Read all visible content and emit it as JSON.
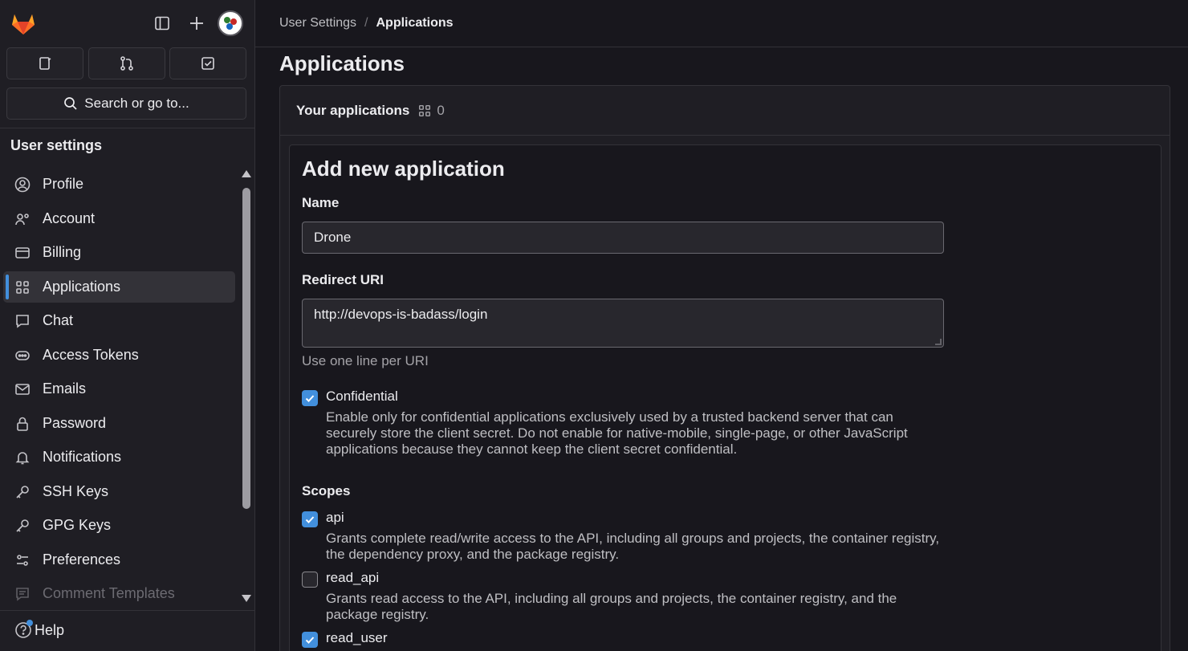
{
  "sidebar": {
    "search_label": "Search or go to...",
    "section_title": "User settings",
    "items": [
      {
        "label": "Profile",
        "icon": "profile-icon"
      },
      {
        "label": "Account",
        "icon": "account-icon"
      },
      {
        "label": "Billing",
        "icon": "billing-icon"
      },
      {
        "label": "Applications",
        "icon": "applications-icon",
        "active": true
      },
      {
        "label": "Chat",
        "icon": "chat-icon"
      },
      {
        "label": "Access Tokens",
        "icon": "token-icon"
      },
      {
        "label": "Emails",
        "icon": "mail-icon"
      },
      {
        "label": "Password",
        "icon": "lock-icon"
      },
      {
        "label": "Notifications",
        "icon": "bell-icon"
      },
      {
        "label": "SSH Keys",
        "icon": "key-icon"
      },
      {
        "label": "GPG Keys",
        "icon": "key-icon"
      },
      {
        "label": "Preferences",
        "icon": "preferences-icon"
      },
      {
        "label": "Comment Templates",
        "icon": "comment-icon"
      }
    ],
    "help_label": "Help"
  },
  "breadcrumb": {
    "parent": "User Settings",
    "separator": "/",
    "current": "Applications"
  },
  "page": {
    "title": "Applications",
    "your_apps_label": "Your applications",
    "app_count": "0"
  },
  "form": {
    "heading": "Add new application",
    "name_label": "Name",
    "name_value": "Drone",
    "redirect_label": "Redirect URI",
    "redirect_value": "http://devops-is-badass/login",
    "redirect_help": "Use one line per URI",
    "confidential_label": "Confidential",
    "confidential_checked": true,
    "confidential_desc": "Enable only for confidential applications exclusively used by a trusted backend server that can securely store the client secret. Do not enable for native-mobile, single-page, or other JavaScript applications because they cannot keep the client secret confidential.",
    "scopes_label": "Scopes",
    "scopes": [
      {
        "name": "api",
        "checked": true,
        "desc": "Grants complete read/write access to the API, including all groups and projects, the container registry, the dependency proxy, and the package registry."
      },
      {
        "name": "read_api",
        "checked": false,
        "desc": "Grants read access to the API, including all groups and projects, the container registry, and the package registry."
      },
      {
        "name": "read_user",
        "checked": true,
        "desc": ""
      }
    ]
  },
  "colors": {
    "accent": "#428fdc",
    "logo_orange": "#e24329"
  }
}
